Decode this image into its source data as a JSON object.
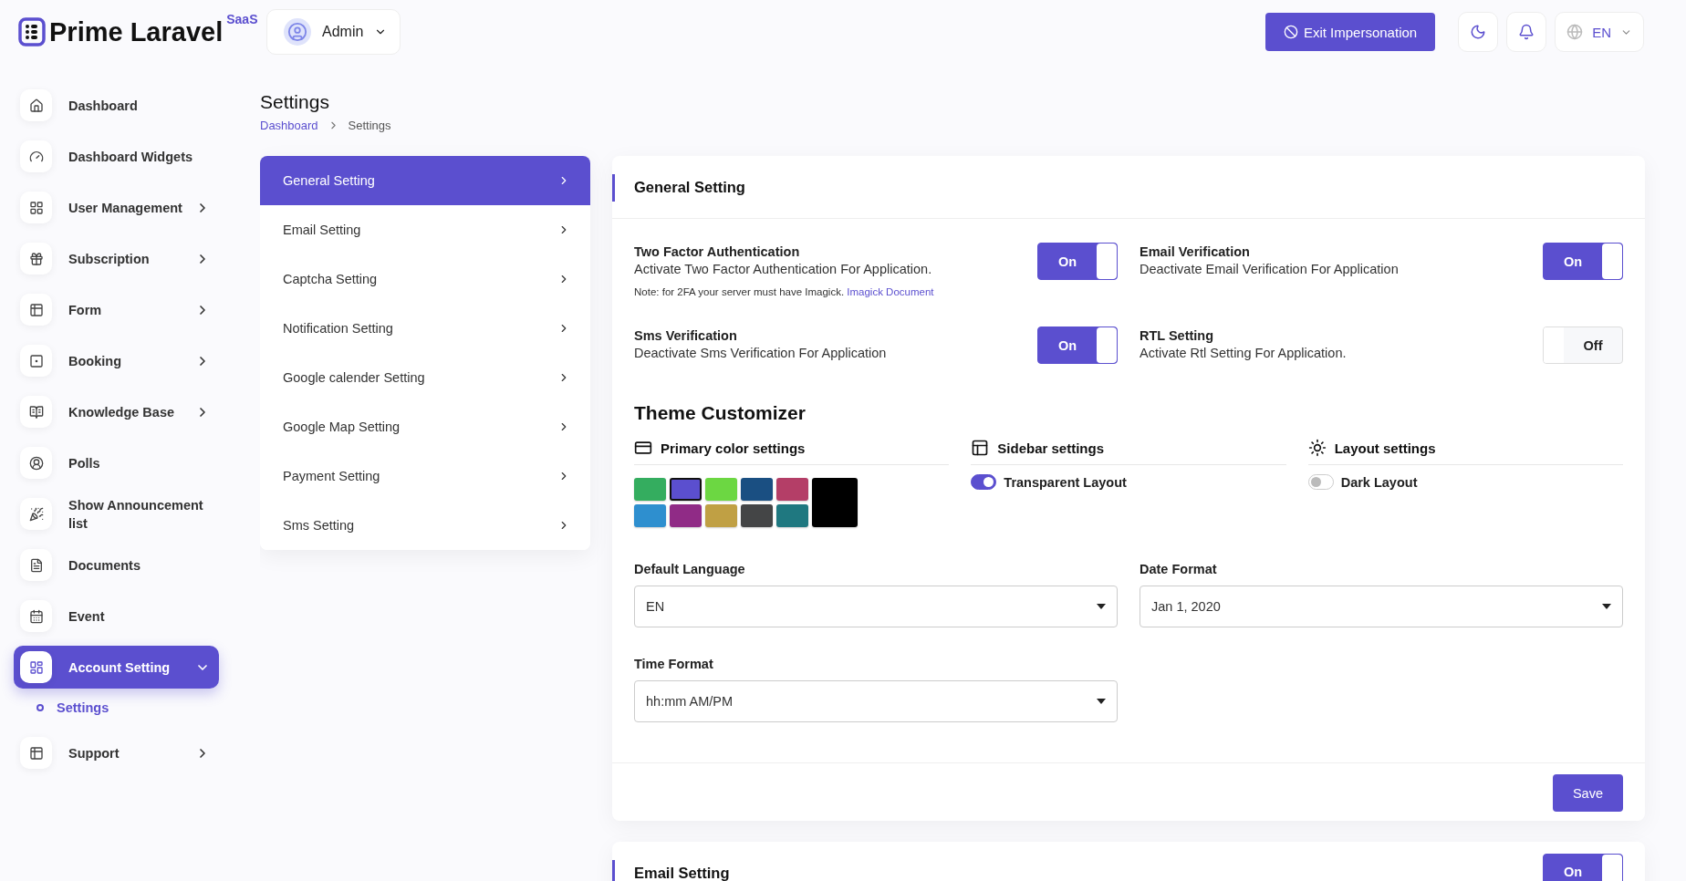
{
  "brand": {
    "name": "Prime Laravel",
    "badge": "SaaS"
  },
  "user_menu": {
    "name": "Admin"
  },
  "topbar": {
    "exit_button": "Exit Impersonation",
    "language": "EN"
  },
  "sidebar": {
    "items": [
      {
        "label": "Dashboard",
        "expandable": false,
        "expanded": false,
        "selected": false
      },
      {
        "label": "Dashboard Widgets",
        "expandable": false,
        "expanded": false,
        "selected": false
      },
      {
        "label": "User Management",
        "expandable": true,
        "expanded": false,
        "selected": false
      },
      {
        "label": "Subscription",
        "expandable": true,
        "expanded": false,
        "selected": false
      },
      {
        "label": "Form",
        "expandable": true,
        "expanded": false,
        "selected": false
      },
      {
        "label": "Booking",
        "expandable": true,
        "expanded": false,
        "selected": false
      },
      {
        "label": "Knowledge Base",
        "expandable": true,
        "expanded": false,
        "selected": false
      },
      {
        "label": "Polls",
        "expandable": false,
        "expanded": false,
        "selected": false
      },
      {
        "label": "Show Announcement list",
        "expandable": false,
        "expanded": false,
        "selected": false
      },
      {
        "label": "Documents",
        "expandable": false,
        "expanded": false,
        "selected": false
      },
      {
        "label": "Event",
        "expandable": false,
        "expanded": false,
        "selected": false
      },
      {
        "label": "Account Setting",
        "expandable": true,
        "expanded": true,
        "selected": true,
        "children": [
          {
            "label": "Settings",
            "selected": true
          }
        ]
      },
      {
        "label": "Support",
        "expandable": true,
        "expanded": false,
        "selected": false
      }
    ]
  },
  "page": {
    "title": "Settings",
    "breadcrumb": [
      {
        "label": "Dashboard",
        "kind": "link"
      },
      {
        "label": "Settings",
        "kind": "current"
      }
    ]
  },
  "settings_menu": [
    {
      "label": "General Setting",
      "selected": true
    },
    {
      "label": "Email Setting",
      "selected": false
    },
    {
      "label": "Captcha Setting",
      "selected": false
    },
    {
      "label": "Notification Setting",
      "selected": false
    },
    {
      "label": "Google calender Setting",
      "selected": false
    },
    {
      "label": "Google Map Setting",
      "selected": false
    },
    {
      "label": "Payment Setting",
      "selected": false
    },
    {
      "label": "Sms Setting",
      "selected": false
    }
  ],
  "general_setting": {
    "title": "General Setting",
    "toggles": [
      {
        "title": "Two Factor Authentication",
        "description": "Activate Two Factor Authentication For Application.",
        "note": "Note: for 2FA your server must have Imagick.",
        "note_link": "Imagick Document",
        "on": true,
        "state_label": "On"
      },
      {
        "title": "Email Verification",
        "description": "Deactivate Email Verification For Application",
        "on": true,
        "state_label": "On"
      },
      {
        "title": "Sms Verification",
        "description": "Deactivate Sms Verification For Application",
        "on": true,
        "state_label": "On"
      },
      {
        "title": "RTL Setting",
        "description": "Activate Rtl Setting For Application.",
        "on": false,
        "state_label": "Off"
      }
    ],
    "theme": {
      "title": "Theme Customizer",
      "primary_colors": {
        "title": "Primary color settings",
        "swatches": [
          {
            "color": "#34ad5f",
            "selected": false
          },
          {
            "color": "#5b4fcf",
            "selected": true
          },
          {
            "color": "#6cd742",
            "selected": false
          },
          {
            "color": "#1a4f82",
            "selected": false
          },
          {
            "color": "#b43e67",
            "selected": false
          },
          {
            "color": "#2e8fcf",
            "selected": false
          },
          {
            "color": "#902b86",
            "selected": false
          },
          {
            "color": "#c0a044",
            "selected": false
          },
          {
            "color": "#444546",
            "selected": false
          },
          {
            "color": "#1f7880",
            "selected": false
          },
          {
            "color": "#000000",
            "selected": false
          }
        ]
      },
      "sidebar_settings": {
        "title": "Sidebar settings",
        "option": {
          "label": "Transparent Layout",
          "on": true
        }
      },
      "layout_settings": {
        "title": "Layout settings",
        "option": {
          "label": "Dark Layout",
          "on": false
        }
      }
    },
    "selects": [
      {
        "label": "Default Language",
        "value": "EN"
      },
      {
        "label": "Date Format",
        "value": "Jan 1, 2020"
      },
      {
        "label": "Time Format",
        "value": "hh:mm AM/PM"
      }
    ],
    "save_button": "Save"
  },
  "email_setting": {
    "title": "Email Setting",
    "on": true,
    "state_label": "On"
  }
}
